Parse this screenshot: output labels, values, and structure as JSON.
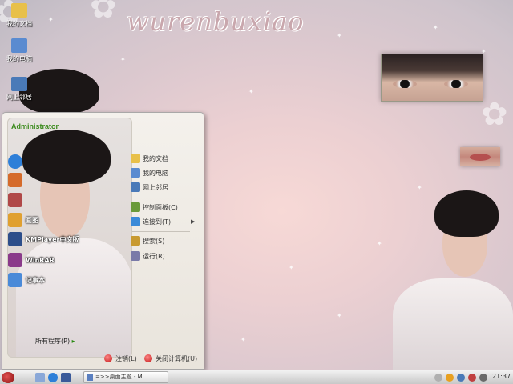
{
  "wallpaper": {
    "title": "wurenbuxiao"
  },
  "desktop_icons": [
    {
      "label": "我的文档",
      "icon": "folder-icon",
      "color": "#e8c04a"
    },
    {
      "label": "我的电脑",
      "icon": "computer-icon",
      "color": "#5a8bd0"
    },
    {
      "label": "网上邻居",
      "icon": "network-icon",
      "color": "#4a7ab8"
    }
  ],
  "start_menu": {
    "user": "Administrator",
    "programs": [
      {
        "label": "",
        "icon": "ie-icon",
        "color": "#2e7fd8"
      },
      {
        "label": "",
        "icon": "ppt-icon",
        "color": "#d56b2b"
      },
      {
        "label": "",
        "icon": "media-icon",
        "color": "#b04848"
      },
      {
        "label": "画图",
        "icon": "paint-icon",
        "color": "#e0a030"
      },
      {
        "label": "KMPlayer中文版",
        "icon": "kmplayer-icon",
        "color": "#2d4e8a"
      },
      {
        "label": "WinRAR",
        "icon": "winrar-icon",
        "color": "#8a3a8a"
      },
      {
        "label": "记事本",
        "icon": "notepad-icon",
        "color": "#4a8ad8"
      }
    ],
    "all_programs": "所有程序(P)",
    "right_items": [
      {
        "label": "我的文档",
        "icon": "folder-icon",
        "color": "#e8c04a"
      },
      {
        "label": "我的电脑",
        "icon": "computer-icon",
        "color": "#5a8bd0"
      },
      {
        "label": "网上邻居",
        "icon": "network-icon",
        "color": "#4a7ab8"
      },
      {
        "label": "控制面板(C)",
        "icon": "control-panel-icon",
        "color": "#6a9a3a"
      },
      {
        "label": "连接到(T)",
        "icon": "connect-icon",
        "color": "#3a8ad8"
      },
      {
        "label": "搜索(S)",
        "icon": "search-icon",
        "color": "#c89a30"
      },
      {
        "label": "运行(R)...",
        "icon": "run-icon",
        "color": "#7a7aa8"
      }
    ],
    "logoff": "注销(L)",
    "shutdown": "关闭计算机(U)"
  },
  "taskbar": {
    "task_label": "=>>桌面主题 - Mi...",
    "clock": "21:37"
  }
}
